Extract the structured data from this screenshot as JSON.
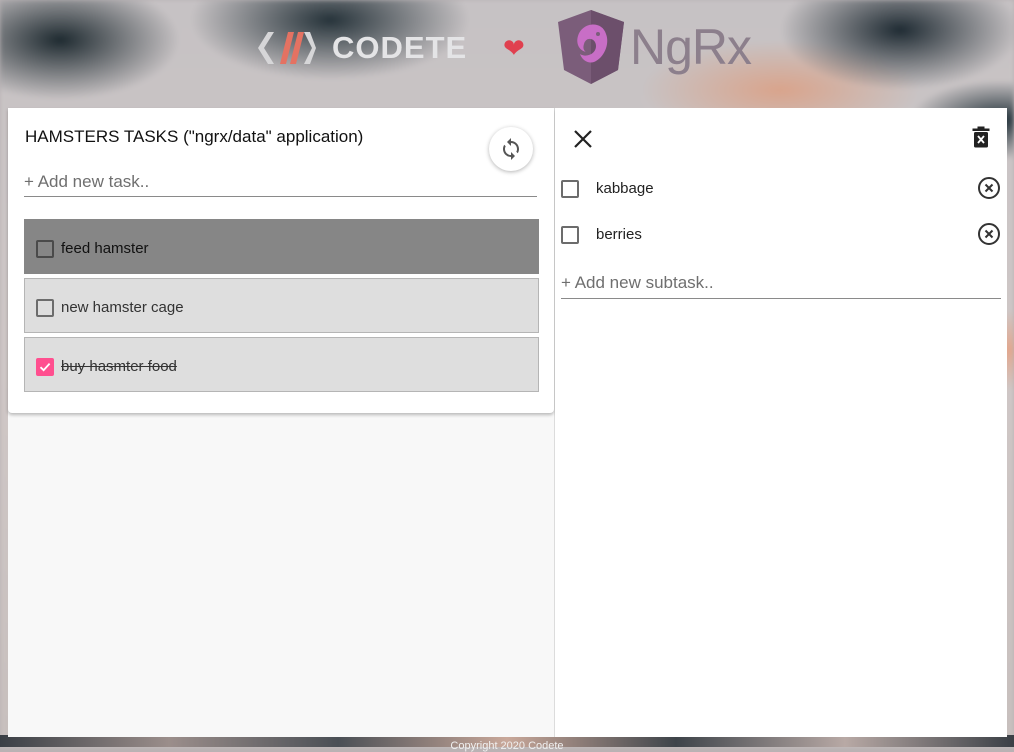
{
  "header": {
    "codete_word": "CODETE",
    "ngrx_word": "NgRx",
    "heart_icon": "heart-icon"
  },
  "tasks_panel": {
    "title": "HAMSTERS TASKS (\"ngrx/data\" application)",
    "refresh_icon": "refresh-icon",
    "new_task_placeholder": "+ Add new task..",
    "tasks": [
      {
        "label": "feed hamster",
        "checked": false,
        "selected": true
      },
      {
        "label": "new hamster cage",
        "checked": false,
        "selected": false
      },
      {
        "label": "buy hasmter food",
        "checked": true,
        "selected": false
      }
    ]
  },
  "detail_panel": {
    "close_icon": "close-icon",
    "delete_icon": "delete-forever-icon",
    "subtasks": [
      {
        "label": "kabbage",
        "checked": false
      },
      {
        "label": "berries",
        "checked": false
      }
    ],
    "new_subtask_placeholder": "+ Add new subtask.."
  },
  "footer": {
    "text": "Copyright 2020 Codete"
  },
  "colors": {
    "accent_pink": "#ff4f8f",
    "heart_red": "#e0404f",
    "selected_task_bg": "#868686",
    "task_bg": "#dedede"
  }
}
